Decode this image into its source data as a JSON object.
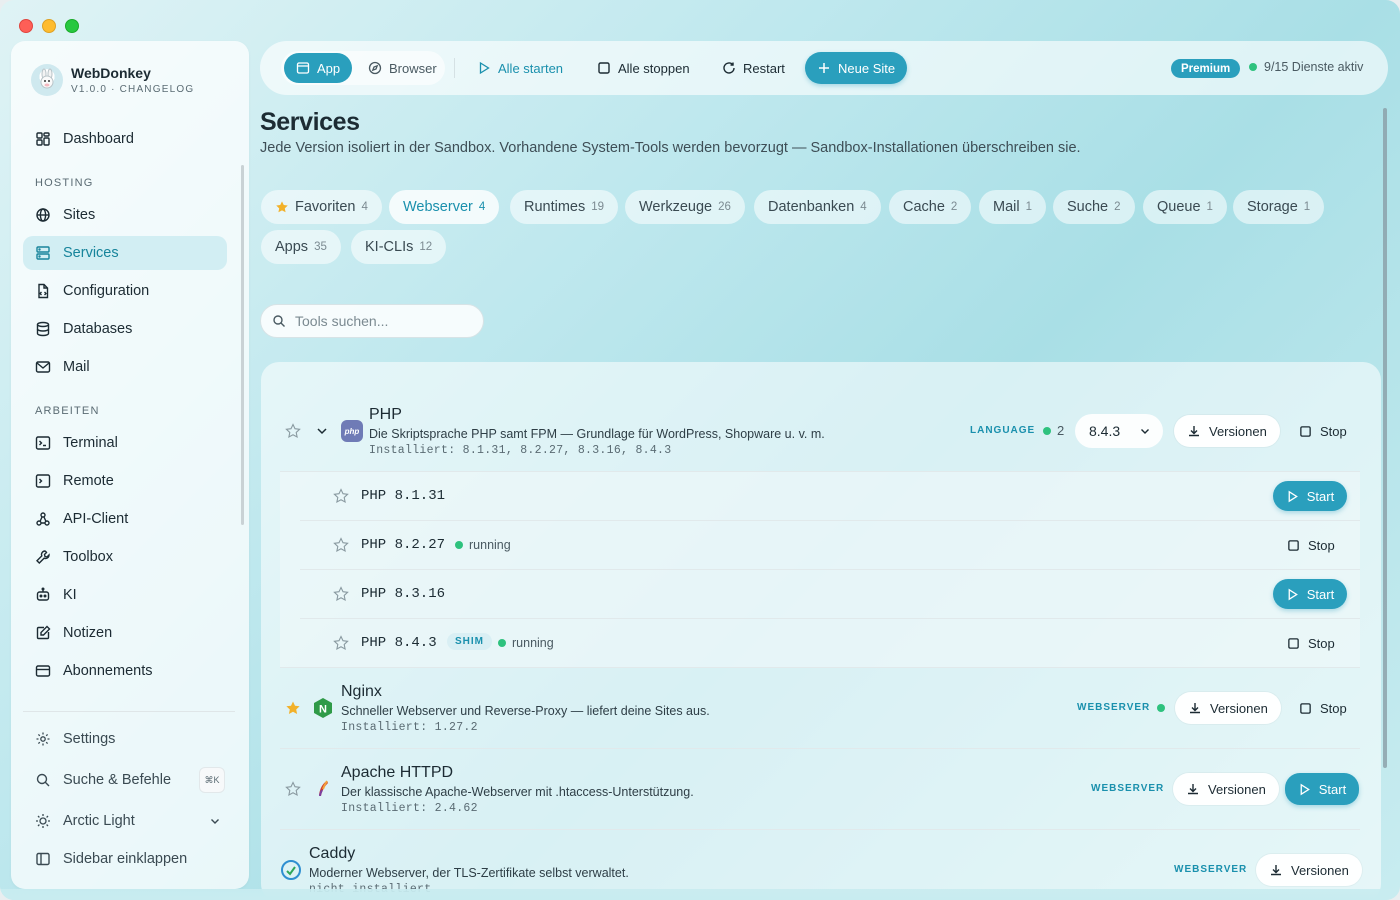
{
  "app": {
    "name": "WebDonkey",
    "version": "V1.0.0 · CHANGELOG"
  },
  "sidebar": {
    "dashboard": "Dashboard",
    "sections": {
      "hosting": "HOSTING",
      "arbeiten": "ARBEITEN"
    },
    "hosting_items": [
      {
        "label": "Sites",
        "icon": "globe-icon"
      },
      {
        "label": "Services",
        "icon": "server-icon",
        "active": true
      },
      {
        "label": "Configuration",
        "icon": "file-code-icon"
      },
      {
        "label": "Databases",
        "icon": "database-icon"
      },
      {
        "label": "Mail",
        "icon": "mail-icon"
      }
    ],
    "work_items": [
      {
        "label": "Terminal",
        "icon": "terminal-icon"
      },
      {
        "label": "Remote",
        "icon": "remote-icon"
      },
      {
        "label": "API-Client",
        "icon": "api-icon"
      },
      {
        "label": "Toolbox",
        "icon": "wrench-icon"
      },
      {
        "label": "KI",
        "icon": "robot-icon"
      },
      {
        "label": "Notizen",
        "icon": "notes-icon"
      },
      {
        "label": "Abonnements",
        "icon": "card-icon"
      }
    ],
    "settings": "Settings",
    "search": "Suche & Befehle",
    "search_shortcut": "⌘K",
    "theme": "Arctic Light",
    "collapse": "Sidebar einklappen"
  },
  "toolbar": {
    "app": "App",
    "browser": "Browser",
    "start_all": "Alle starten",
    "stop_all": "Alle stoppen",
    "restart": "Restart",
    "new_site": "Neue Site",
    "premium": "Premium",
    "status": "9/15 Dienste aktiv"
  },
  "page": {
    "title": "Services",
    "description": "Jede Version isoliert in der Sandbox. Vorhandene System-Tools werden bevorzugt — Sandbox-Installationen überschreiben sie."
  },
  "filters": [
    {
      "label": "Favoriten",
      "count": "4"
    },
    {
      "label": "Webserver",
      "count": "4",
      "active": true
    },
    {
      "label": "Runtimes",
      "count": "19"
    },
    {
      "label": "Werkzeuge",
      "count": "26"
    },
    {
      "label": "Datenbanken",
      "count": "4"
    },
    {
      "label": "Cache",
      "count": "2"
    },
    {
      "label": "Mail",
      "count": "1"
    },
    {
      "label": "Suche",
      "count": "2"
    },
    {
      "label": "Queue",
      "count": "1"
    },
    {
      "label": "Storage",
      "count": "1"
    },
    {
      "label": "Apps",
      "count": "35"
    },
    {
      "label": "KI-CLIs",
      "count": "12"
    }
  ],
  "search": {
    "placeholder": "Tools suchen..."
  },
  "services": {
    "php": {
      "name": "PHP",
      "description": "Die Skriptsprache PHP samt FPM — Grundlage für WordPress, Shopware u. v. m.",
      "installed": "Installiert: 8.1.31, 8.2.27, 8.3.16, 8.4.3",
      "tag": "LANGUAGE",
      "running_count": "2",
      "selected_version": "8.4.3",
      "versions_label": "Versionen",
      "stop_label": "Stop",
      "versions": [
        {
          "label": "PHP 8.1.31",
          "action": "Start"
        },
        {
          "label": "PHP 8.2.27",
          "status": "running",
          "action": "Stop"
        },
        {
          "label": "PHP 8.3.16",
          "action": "Start"
        },
        {
          "label": "PHP 8.4.3",
          "badge": "SHIM",
          "status": "running",
          "action": "Stop"
        }
      ]
    },
    "nginx": {
      "name": "Nginx",
      "description": "Schneller Webserver und Reverse-Proxy — liefert deine Sites aus.",
      "installed": "Installiert: 1.27.2",
      "tag": "WEBSERVER",
      "versions_label": "Versionen",
      "stop_label": "Stop"
    },
    "apache": {
      "name": "Apache HTTPD",
      "description": "Der klassische Apache-Webserver mit .htaccess-Unterstützung.",
      "installed": "Installiert: 2.4.62",
      "tag": "WEBSERVER",
      "versions_label": "Versionen",
      "start_label": "Start"
    },
    "caddy": {
      "name": "Caddy",
      "description": "Moderner Webserver, der TLS-Zertifikate selbst verwaltet.",
      "installed": "nicht installiert",
      "tag": "WEBSERVER",
      "versions_label": "Versionen"
    }
  },
  "colors": {
    "accent": "#2a9fbd",
    "running": "#2ec27e",
    "star": "#f2b12a"
  }
}
